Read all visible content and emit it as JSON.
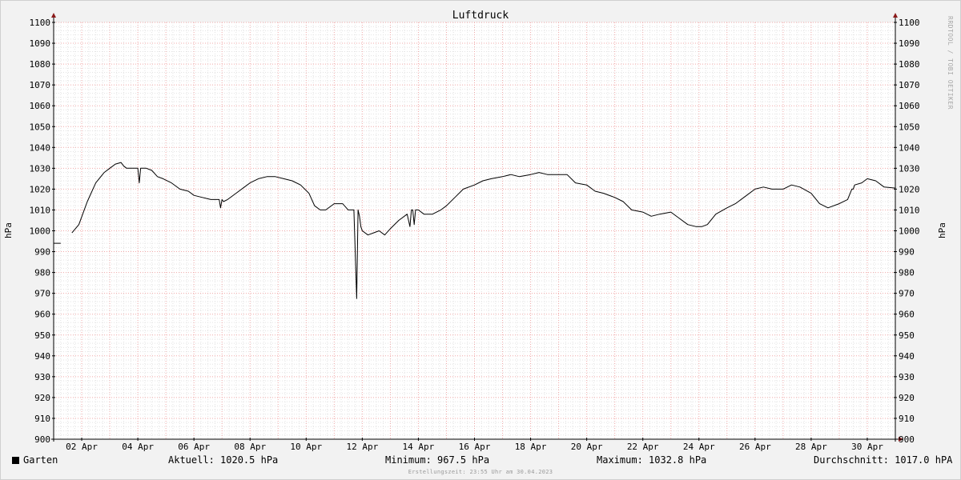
{
  "chart_data": {
    "type": "line",
    "title": "Luftdruck",
    "ylabel_left": "hPa",
    "ylabel_right": "hPa",
    "ylim": [
      900,
      1100
    ],
    "ytick_step": 10,
    "ytick_labels": [
      "900",
      "910",
      "920",
      "930",
      "940",
      "950",
      "960",
      "970",
      "980",
      "990",
      "1000",
      "1010",
      "1020",
      "1030",
      "1040",
      "1050",
      "1060",
      "1070",
      "1080",
      "1090",
      "1100"
    ],
    "xlim": [
      0,
      30
    ],
    "xticks": [
      {
        "day": 1,
        "label": "02 Apr"
      },
      {
        "day": 3,
        "label": "04 Apr"
      },
      {
        "day": 5,
        "label": "06 Apr"
      },
      {
        "day": 7,
        "label": "08 Apr"
      },
      {
        "day": 9,
        "label": "10 Apr"
      },
      {
        "day": 11,
        "label": "12 Apr"
      },
      {
        "day": 13,
        "label": "14 Apr"
      },
      {
        "day": 15,
        "label": "16 Apr"
      },
      {
        "day": 17,
        "label": "18 Apr"
      },
      {
        "day": 19,
        "label": "20 Apr"
      },
      {
        "day": 21,
        "label": "22 Apr"
      },
      {
        "day": 23,
        "label": "24 Apr"
      },
      {
        "day": 25,
        "label": "26 Apr"
      },
      {
        "day": 27,
        "label": "28 Apr"
      },
      {
        "day": 29,
        "label": "30 Apr"
      }
    ],
    "grid": true,
    "series": [
      {
        "name": "Garten",
        "color": "#000000",
        "segments": [
          {
            "x": [
              0,
              0.25
            ],
            "y": [
              994,
              994
            ]
          },
          {
            "x": [
              0.65,
              0.9,
              1.2,
              1.5,
              1.8,
              2.0,
              2.2,
              2.4,
              2.5,
              2.6,
              2.8,
              3.0,
              3.05,
              3.1,
              3.15,
              3.3,
              3.5,
              3.7,
              3.9,
              4.2,
              4.5,
              4.8,
              5.0,
              5.3,
              5.6,
              5.9,
              5.95,
              6.0,
              6.05,
              6.2,
              6.5,
              6.8,
              7.0,
              7.3,
              7.6,
              7.9,
              8.2,
              8.5,
              8.8,
              9.1,
              9.3,
              9.5,
              9.7,
              10.0,
              10.3,
              10.5,
              10.7,
              10.8,
              10.85,
              10.9,
              10.95,
              11.0,
              11.2,
              11.4,
              11.6,
              11.8,
              12.0,
              12.3,
              12.6,
              12.7,
              12.75,
              12.8,
              12.85,
              12.9,
              12.95,
              13.0,
              13.2,
              13.5,
              13.8,
              14.0,
              14.3,
              14.6,
              15.0,
              15.3,
              15.6,
              16.0,
              16.3,
              16.6,
              17.0,
              17.3,
              17.6,
              18.0,
              18.3,
              18.6,
              19.0,
              19.3,
              19.6,
              20.0,
              20.3,
              20.6,
              21.0,
              21.3,
              21.6,
              22.0,
              22.3,
              22.6,
              22.9,
              23.1,
              23.3,
              23.6,
              24.0,
              24.3,
              24.6,
              25.0,
              25.3,
              25.6,
              26.0,
              26.3,
              26.6,
              27.0,
              27.3,
              27.6,
              28.0,
              28.3,
              28.45,
              28.5,
              28.55,
              28.8,
              29.0,
              29.3,
              29.6,
              30.0
            ],
            "y": [
              999,
              1003,
              1014,
              1023,
              1028,
              1030,
              1032,
              1032.8,
              1031,
              1030,
              1030,
              1030,
              1023,
              1030,
              1030,
              1030,
              1029,
              1026,
              1025,
              1023,
              1020,
              1019,
              1017,
              1016,
              1015,
              1015,
              1011,
              1015,
              1014,
              1015,
              1018,
              1021,
              1023,
              1025,
              1026,
              1026,
              1025,
              1024,
              1022,
              1018,
              1012,
              1010,
              1010,
              1013,
              1013,
              1010,
              1010,
              967.5,
              1010,
              1007,
              1002,
              1000,
              998,
              999,
              1000,
              998,
              1001,
              1005,
              1008,
              1002,
              1010,
              1010,
              1003,
              1010,
              1010,
              1010,
              1008,
              1008,
              1010,
              1012,
              1016,
              1020,
              1022,
              1024,
              1025,
              1026,
              1027,
              1026,
              1027,
              1028,
              1027,
              1027,
              1027,
              1023,
              1022,
              1019,
              1018,
              1016,
              1014,
              1010,
              1009,
              1007,
              1008,
              1009,
              1006,
              1003,
              1002,
              1002,
              1003,
              1008,
              1011,
              1013,
              1016,
              1020,
              1021,
              1020,
              1020,
              1022,
              1021,
              1018,
              1013,
              1011,
              1013,
              1015,
              1020,
              1020,
              1022,
              1023,
              1025,
              1024,
              1021,
              1020.5
            ]
          }
        ]
      }
    ]
  },
  "legend": {
    "series_name": "Garten",
    "current": "Aktuell: 1020.5 hPa",
    "minimum": "Minimum: 967.5 hPa",
    "maximum": "Maximum: 1032.8 hPa",
    "average": "Durchschnitt: 1017.0 hPA"
  },
  "footer": {
    "timestamp": "Erstellungszeit: 23:55 Uhr am 30.04.2023"
  },
  "watermark": "RRDTOOL / TOBI OETIKER"
}
